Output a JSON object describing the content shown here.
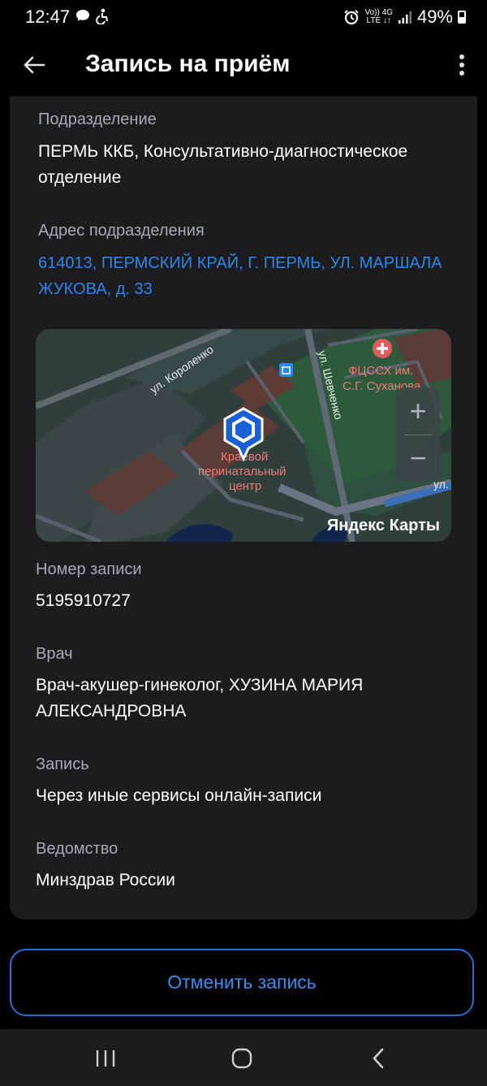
{
  "status_bar": {
    "time": "12:47",
    "battery_percent": "49%",
    "network_top": "Vo)) 4G",
    "network_bottom": "LTE ↓↑"
  },
  "app_bar": {
    "title": "Запись на приём"
  },
  "details": {
    "department_label": "Подразделение",
    "department_value": "ПЕРМЬ ККБ, Консультативно-диагностическое отделение",
    "address_label": "Адрес подразделения",
    "address_value": "614013, ПЕРМСКИЙ КРАЙ, Г. ПЕРМЬ, УЛ. МАРШАЛА ЖУКОВА, д. 33",
    "record_number_label": "Номер записи",
    "record_number_value": "5195910727",
    "doctor_label": "Врач",
    "doctor_value": "Врач-акушер-гинеколог, ХУЗИНА МАРИЯ АЛЕКСАНДРОВНА",
    "booking_label": "Запись",
    "booking_value": "Через иные сервисы онлайн-записи",
    "agency_label": "Ведомство",
    "agency_value": "Минздрав России"
  },
  "map": {
    "street_korolenko": "ул. Короленко",
    "street_shevchenko": "ул. Шевченко",
    "street_partial": "ул.",
    "poi_fcssh_line1": "ФЦССХ им.",
    "poi_fcssh_line2": "С.Г. Суханова",
    "poi_center_line1": "Краевой",
    "poi_center_line2": "перинатальный",
    "poi_center_line3": "центр",
    "zoom_in": "+",
    "zoom_out": "−",
    "brand": "Яндекс Карты"
  },
  "actions": {
    "cancel_label": "Отменить запись"
  },
  "colors": {
    "link": "#2d86e8",
    "button_border": "#2d6ecf",
    "card_bg": "#1c1c1e"
  }
}
